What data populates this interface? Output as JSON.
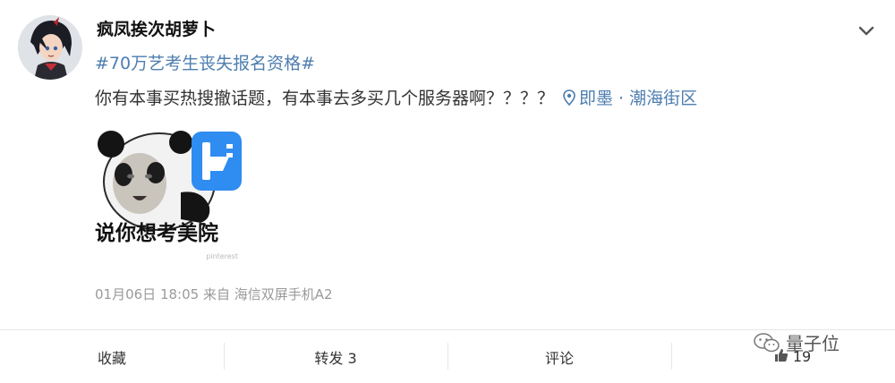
{
  "post": {
    "username": "疯凤挨次胡萝卜",
    "hashtag": "#70万艺考生丧失报名资格#",
    "text": "你有本事买热搜撤话题，有本事去多买几个服务器啊？？？？",
    "location": "即墨 · 潮海街区",
    "meme_caption": "说你想考美院",
    "meme_watermark": "pinterest",
    "timestamp": "01月06日 18:05",
    "source_prefix": "来自",
    "source_device": "海信双屏手机A2"
  },
  "actions": {
    "favorite": "收藏",
    "repost": "转发 3",
    "comment": "评论",
    "like_count": "19"
  },
  "watermark": {
    "label": "量子位"
  },
  "icons": {
    "menu": "chevron-down-icon",
    "location": "location-pin-icon",
    "like": "thumb-up-icon",
    "watermark": "wechat-icon"
  },
  "colors": {
    "link": "#4d7eaf",
    "text": "#333333",
    "meta": "#9a9a9a",
    "divider": "#e6e6e6"
  }
}
